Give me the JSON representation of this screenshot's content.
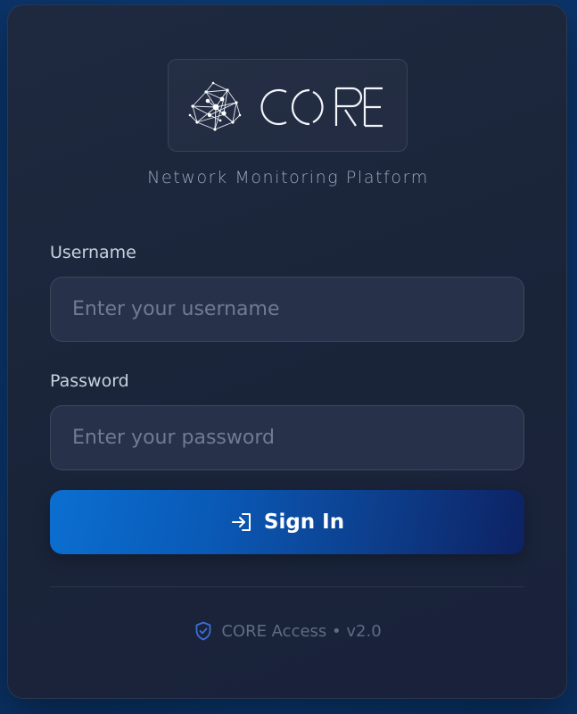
{
  "brand": {
    "name": "CORE",
    "subtitle": "Network Monitoring Platform",
    "logo_icon": "network-nodes-icon"
  },
  "form": {
    "username": {
      "label": "Username",
      "placeholder": "Enter your username",
      "value": ""
    },
    "password": {
      "label": "Password",
      "placeholder": "Enter your password",
      "value": ""
    },
    "submit": {
      "label": "Sign In",
      "icon": "sign-in-icon"
    }
  },
  "footer": {
    "icon": "shield-check-icon",
    "text": "CORE Access • v2.0"
  },
  "colors": {
    "background": "#0b3d7a",
    "card": "#1c263b",
    "input": "#27324a",
    "button_start": "#0b6fd0",
    "button_end": "#0d2263",
    "accent_icon": "#3b6fd6"
  }
}
